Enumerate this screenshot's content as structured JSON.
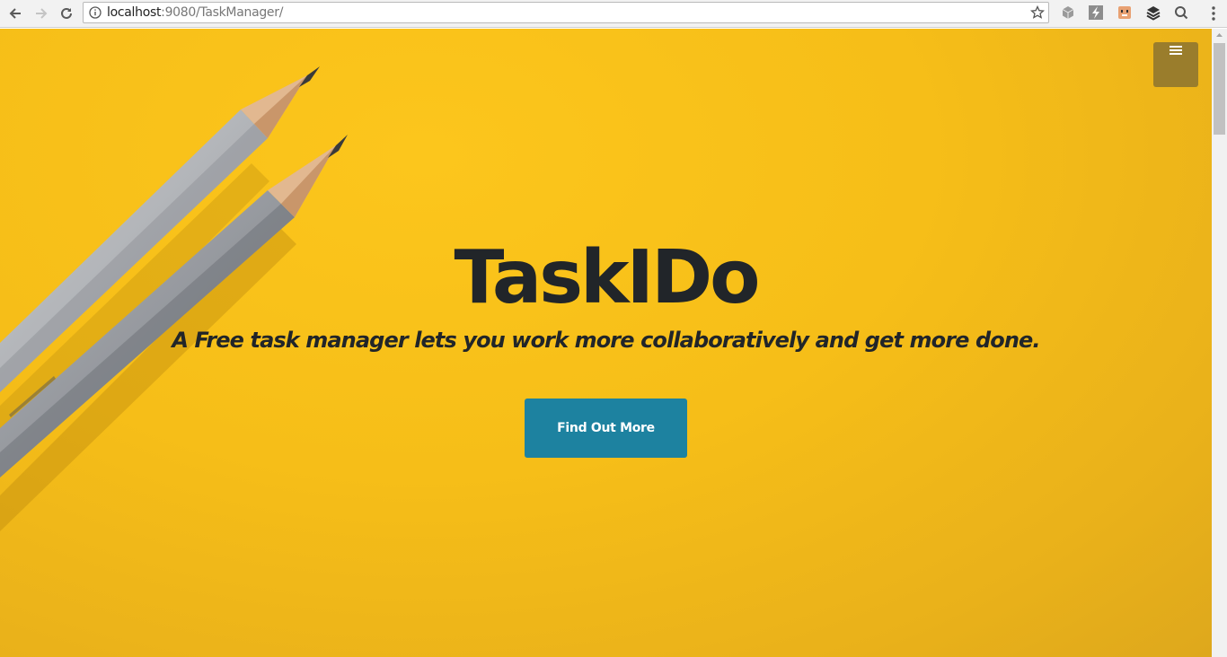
{
  "browser": {
    "url_host": "localhost",
    "url_rest": ":9080/TaskManager/"
  },
  "hero": {
    "title": "TaskIDo",
    "subtitle": "A Free task manager lets you work more collaboratively and get more done.",
    "cta_label": "Find Out More"
  },
  "colors": {
    "background": "#f6be18",
    "cta": "#1d82a0",
    "menu_toggle": "#9a7d2c",
    "text": "#212529"
  }
}
